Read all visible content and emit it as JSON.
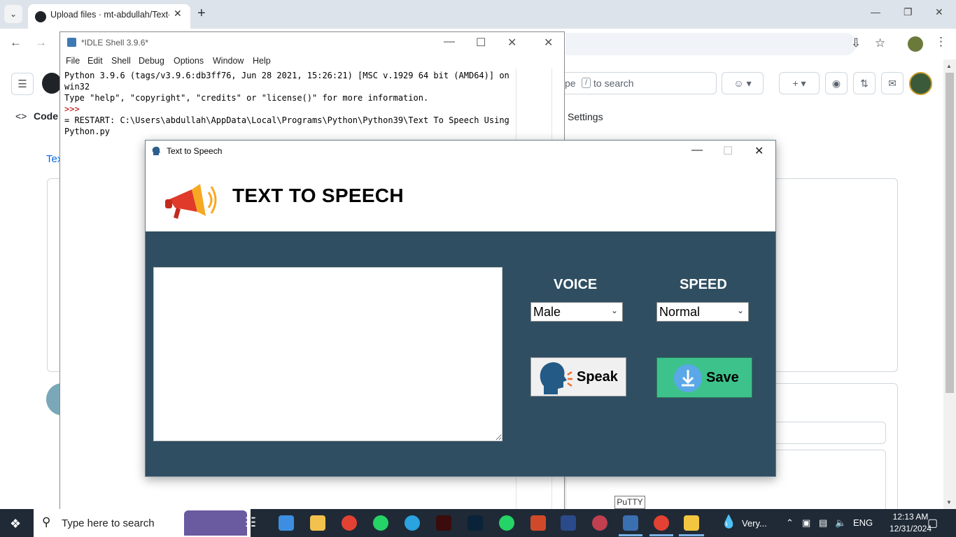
{
  "browser": {
    "tab_title": "Upload files · mt-abdullah/Text-",
    "tab_close": "✕",
    "new_tab": "+",
    "tab_menu": "⌄"
  },
  "github": {
    "code_tab": "Code",
    "settings_tab": "Settings",
    "repo_partial": "Tex",
    "search_hint_1": "ype",
    "search_slash": "/",
    "search_hint_2": "to search"
  },
  "idle": {
    "title": "*IDLE Shell 3.9.6*",
    "menu": [
      "File",
      "Edit",
      "Shell",
      "Debug",
      "Options",
      "Window",
      "Help"
    ],
    "line1": "Python 3.9.6 (tags/v3.9.6:db3ff76, Jun 28 2021, 15:26:21) [MSC v.1929 64 bit (AMD64)] on win32",
    "line2": "Type \"help\", \"copyright\", \"credits\" or \"license()\" for more information.",
    "prompt": ">>>",
    "line3": "= RESTART: C:\\Users\\abdullah\\AppData\\Local\\Programs\\Python\\Python39\\Text To Speech Using Python.py"
  },
  "tts": {
    "window_title": "Text to Speech",
    "heading": "TEXT TO SPEECH",
    "voice_label": "VOICE",
    "voice_value": "Male",
    "speed_label": "SPEED",
    "speed_value": "Normal",
    "speak_label": "Speak",
    "save_label": "Save",
    "text_content": ""
  },
  "tooltip": "PuTTY",
  "taskbar": {
    "search_placeholder": "Type here to search",
    "weather": "Very...",
    "lang": "ENG",
    "time": "12:13 AM",
    "date": "12/31/2024"
  },
  "colors": {
    "tts_body": "#2f4e62",
    "save_button": "#3ec28c",
    "taskbar": "#1f2a36"
  }
}
